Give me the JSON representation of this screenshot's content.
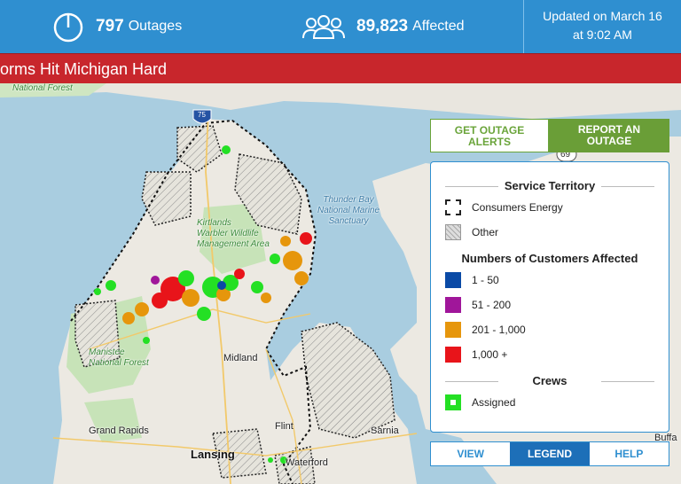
{
  "header": {
    "outages_count": "797",
    "outages_label": "Outages",
    "affected_count": "89,823",
    "affected_label": "Affected",
    "updated_line1": "Updated on March 16",
    "updated_line2": "at 9:02 AM"
  },
  "banner": {
    "text": "orms Hit Michigan Hard"
  },
  "map": {
    "labels": {
      "national_forest_top": "National Forest",
      "highway_75": "75",
      "highway_69": "69",
      "thunder_bay": "Thunder Bay\nNational Marine\nSanctuary",
      "kirtlands": "Kirtlands\nWarbler Wildlife\nManagement Area",
      "manistee": "Manistee\nNational Forest",
      "midland": "Midland",
      "grand_rapids": "Grand Rapids",
      "flint": "Flint",
      "sarnia": "Sarnia",
      "lansing": "Lansing",
      "waterford": "Waterford",
      "buffalo": "Buffa"
    }
  },
  "actions": {
    "get_alerts": "GET OUTAGE\nALERTS",
    "report": "REPORT AN\nOUTAGE"
  },
  "legend": {
    "service_territory_title": "Service Territory",
    "consumers_energy": "Consumers Energy",
    "other": "Other",
    "customers_title": "Numbers of Customers Affected",
    "ranges": [
      {
        "label": "1 - 50",
        "color": "#0a4aa6"
      },
      {
        "label": "51 - 200",
        "color": "#a0169a"
      },
      {
        "label": "201 - 1,000",
        "color": "#e6960c"
      },
      {
        "label": "1,000 +",
        "color": "#e8141a"
      }
    ],
    "crews_title": "Crews",
    "assigned": "Assigned"
  },
  "tabs": {
    "view": "VIEW",
    "legend": "LEGEND",
    "help": "HELP"
  },
  "colors": {
    "header_blue": "#2f8fd0",
    "banner_red": "#c8262c",
    "action_green": "#6a9e37",
    "crew_green": "#24e024"
  }
}
